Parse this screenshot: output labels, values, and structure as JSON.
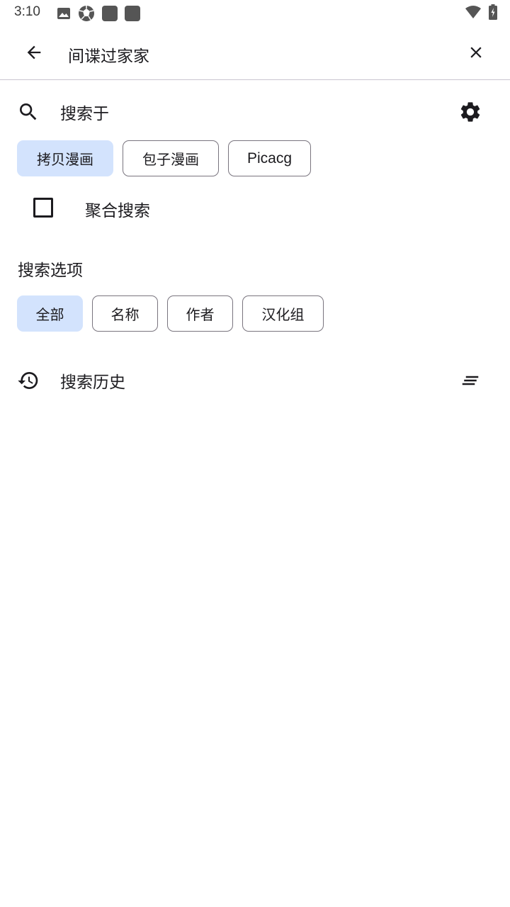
{
  "status_bar": {
    "time": "3:10",
    "left_icons": [
      "image-icon",
      "aperture-icon",
      "app-square-icon",
      "app-square-icon"
    ],
    "right_icons": [
      "wifi-icon",
      "battery-icon"
    ]
  },
  "app_bar": {
    "query": "间谍过家家",
    "back_icon": "arrow-back-icon",
    "clear_icon": "close-icon"
  },
  "search_in": {
    "title": "搜索于",
    "icon": "search-icon",
    "action_icon": "gear-icon",
    "sources": [
      {
        "label": "拷贝漫画",
        "selected": true
      },
      {
        "label": "包子漫画",
        "selected": false
      },
      {
        "label": "Picacg",
        "selected": false
      }
    ]
  },
  "aggregate": {
    "label": "聚合搜索",
    "checked": false
  },
  "options": {
    "title": "搜索选项",
    "items": [
      {
        "label": "全部",
        "selected": true
      },
      {
        "label": "名称",
        "selected": false
      },
      {
        "label": "作者",
        "selected": false
      },
      {
        "label": "汉化组",
        "selected": false
      }
    ]
  },
  "history": {
    "title": "搜索历史",
    "icon": "history-icon",
    "action_icon": "clear-all-icon"
  },
  "colors": {
    "selected_chip": "#d3e3fd",
    "chip_border": "#79747e",
    "text": "#1c1b1f"
  }
}
